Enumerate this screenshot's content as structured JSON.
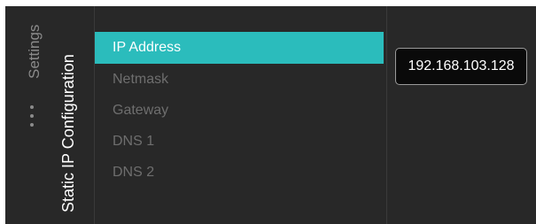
{
  "breadcrumb": {
    "parent": "Settings",
    "current": "Static IP Configuration"
  },
  "menu": {
    "items": [
      {
        "label": "IP Address",
        "selected": true
      },
      {
        "label": "Netmask",
        "selected": false
      },
      {
        "label": "Gateway",
        "selected": false
      },
      {
        "label": "DNS 1",
        "selected": false
      },
      {
        "label": "DNS 2",
        "selected": false
      }
    ]
  },
  "value_field": {
    "value": "192.168.103.128"
  },
  "colors": {
    "background": "#282828",
    "accent": "#2bbcbc",
    "selected_text": "#ffffff",
    "inactive_text": "#6e6e6e",
    "breadcrumb_text": "#8b8b8b",
    "value_box_background": "#0a0a0a",
    "value_box_border": "#9a9a9a"
  },
  "icons": {
    "breadcrumb_more": "ellipsis-icon"
  }
}
